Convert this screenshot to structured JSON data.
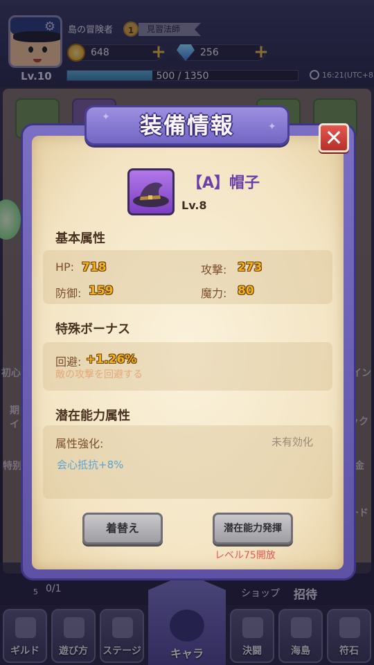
{
  "player": {
    "name": "島の冒険者",
    "rank": "1",
    "title": "見習法師",
    "level": "Lv.10",
    "gold": "648",
    "gems": "256",
    "xp_text": "500 / 1350",
    "xp_fraction": 0.37,
    "time": "16:21(UTC+8)"
  },
  "background": {
    "side_labels_left": [
      "初心",
      "期",
      "イ",
      "特别"
    ],
    "side_labels_right": [
      "イン",
      "ック",
      "金",
      "ード"
    ],
    "quest_progress": "0/1",
    "quest_count": "5",
    "shop_label": "ショップ",
    "invite_label": "招待"
  },
  "nav": {
    "items": [
      "ギルド",
      "遊び方",
      "ステージ",
      "キャラ",
      "決闘",
      "海島",
      "符石"
    ]
  },
  "modal": {
    "title": "装備情報",
    "close_label": "✕",
    "item": {
      "name": "【A】帽子",
      "level": "Lv.8",
      "icon": "wizard-hat-icon"
    },
    "base_section": "基本属性",
    "stats": [
      {
        "label": "HP:",
        "value": "718"
      },
      {
        "label": "攻撃:",
        "value": "273"
      },
      {
        "label": "防御:",
        "value": "159"
      },
      {
        "label": "魔力:",
        "value": "80"
      }
    ],
    "bonus_section": "特殊ボーナス",
    "bonus": {
      "label": "回避:",
      "value": "+1.26%",
      "desc": "敵の攻撃を回避する"
    },
    "potential_section": "潜在能力属性",
    "potential": {
      "label": "属性強化:",
      "status": "未有効化",
      "value": "会心抵抗+8%"
    },
    "buttons": {
      "change": "着替え",
      "activate": "潜在能力発揮"
    },
    "unlock_note": "レベル75開放"
  }
}
